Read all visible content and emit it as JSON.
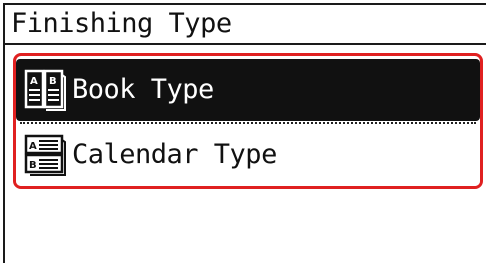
{
  "title": "Finishing Type",
  "menu": {
    "items": [
      {
        "label": "Book Type",
        "icon": "book-type-icon",
        "selected": true
      },
      {
        "label": "Calendar Type",
        "icon": "calendar-type-icon",
        "selected": false
      }
    ]
  },
  "colors": {
    "focus_border": "#e02020",
    "selected_bg": "#111111",
    "selected_text": "#ffffff",
    "text": "#111111"
  }
}
